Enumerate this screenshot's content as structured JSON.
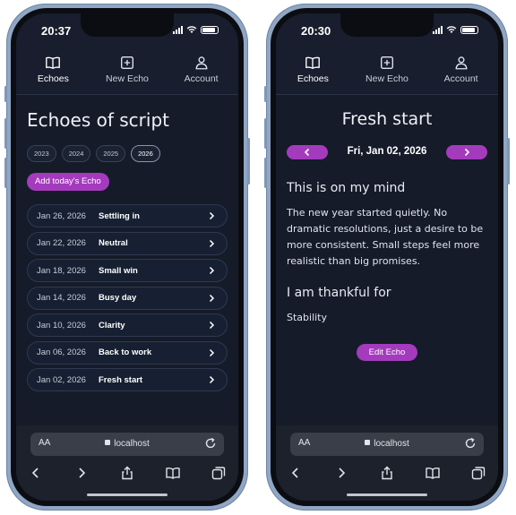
{
  "status": {
    "time": "20:37",
    "time_right": "20:30"
  },
  "nav": {
    "echoes": "Echoes",
    "new_echo": "New Echo",
    "account": "Account"
  },
  "list_page": {
    "title": "Echoes of script",
    "years": [
      "2023",
      "2024",
      "2025",
      "2026"
    ],
    "active_year": "2026",
    "add_button": "Add today's Echo",
    "echoes": [
      {
        "date": "Jan 26, 2026",
        "title": "Settling in"
      },
      {
        "date": "Jan 22, 2026",
        "title": "Neutral"
      },
      {
        "date": "Jan 18, 2026",
        "title": "Small win"
      },
      {
        "date": "Jan 14, 2026",
        "title": "Busy day"
      },
      {
        "date": "Jan 10, 2026",
        "title": "Clarity"
      },
      {
        "date": "Jan 06, 2026",
        "title": "Back to work"
      },
      {
        "date": "Jan 02, 2026",
        "title": "Fresh start"
      }
    ]
  },
  "detail_page": {
    "title": "Fresh start",
    "date": "Fri, Jan 02, 2026",
    "section1_heading": "This is on my mind",
    "section1_text": "The new year started quietly. No dramatic resolutions, just a desire to be more consistent. Small steps feel more realistic than big promises.",
    "section2_heading": "I am thankful for",
    "section2_text": "Stability",
    "edit_button": "Edit Echo"
  },
  "browser": {
    "aa": "AA",
    "url": "localhost"
  },
  "colors": {
    "accent": "#a43bbd",
    "background": "#151b29",
    "frame": "#8fa6c4"
  },
  "icons": [
    "book-icon",
    "plus-square-icon",
    "person-icon",
    "chevron-right-icon",
    "chevron-left-icon",
    "lock-icon",
    "reload-icon",
    "back-icon",
    "forward-icon",
    "share-icon",
    "bookmarks-icon",
    "tabs-icon"
  ]
}
